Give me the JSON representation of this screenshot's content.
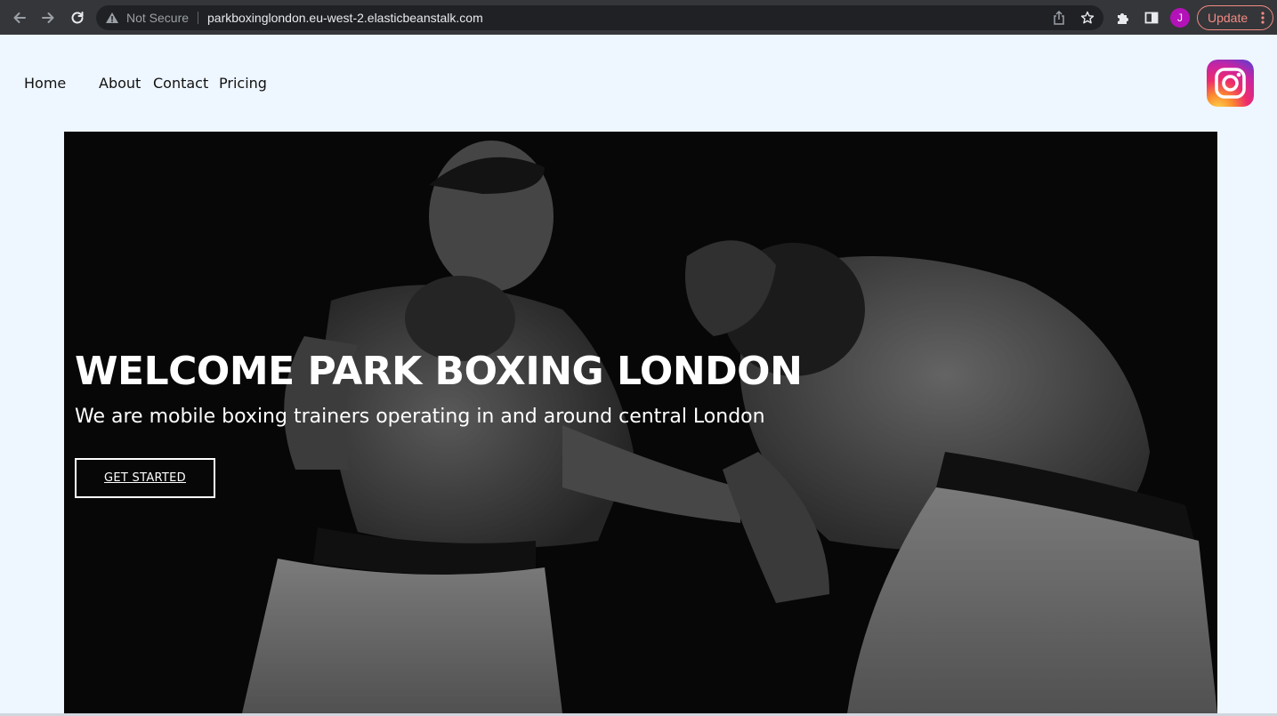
{
  "browser": {
    "security_label": "Not Secure",
    "url": "parkboxinglondon.eu-west-2.elasticbeanstalk.com",
    "profile_initial": "J",
    "update_label": "Update",
    "icons": [
      "back-arrow-icon",
      "forward-arrow-icon",
      "reload-icon",
      "warning-icon",
      "share-icon",
      "bookmark-star-icon",
      "extensions-puzzle-icon",
      "side-panel-icon",
      "more-vert-icon"
    ]
  },
  "nav": {
    "items": [
      {
        "label": "Home"
      },
      {
        "label": "About"
      },
      {
        "label": "Contact"
      },
      {
        "label": "Pricing"
      }
    ],
    "social_icon": "instagram-icon"
  },
  "hero": {
    "title": "WELCOME PARK BOXING LONDON",
    "subtitle": "We are mobile boxing trainers operating in and around central London",
    "cta_label": "GET STARTED"
  },
  "colors": {
    "chrome_bg": "#35363a",
    "omnibox_bg": "#202124",
    "page_bg": "#eef6ff",
    "update_accent": "#f28b82",
    "avatar": "#b312b8"
  }
}
